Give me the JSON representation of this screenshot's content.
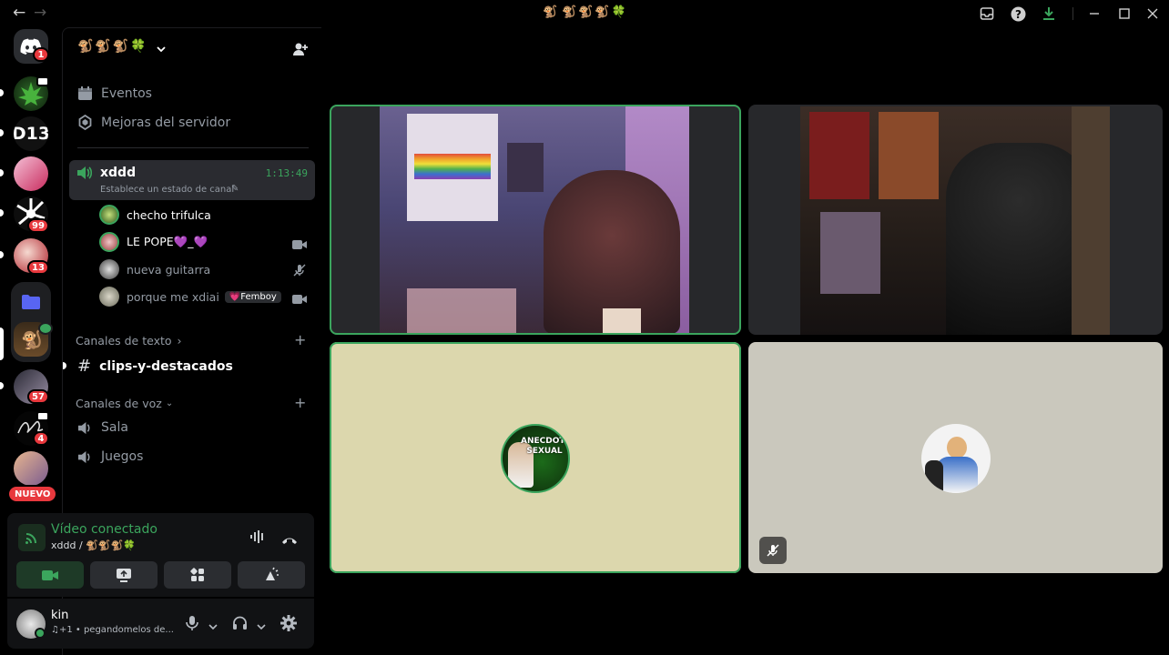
{
  "window": {
    "title": "🐒🐒🐒🍀"
  },
  "rail": {
    "home_badge": "1",
    "badges": [
      "99",
      "13",
      "57",
      "4"
    ],
    "new_label": "NUEVO",
    "d13_label": "D13"
  },
  "sidebar": {
    "server_name": "🐒🐒🐒🍀",
    "items": [
      {
        "label": "Eventos"
      },
      {
        "label": "Mejoras del servidor"
      }
    ],
    "active_voice": {
      "name": "xddd",
      "timer": "1:13:49",
      "status": "Establece un estado de canal"
    },
    "participants": [
      {
        "name": "checho trifulca"
      },
      {
        "name": "LE POPE💜_💜"
      },
      {
        "name": "nueva guitarra"
      },
      {
        "name": "porque me xdiai",
        "tag": "💗Femboy"
      }
    ],
    "text_category": "Canales de texto",
    "text_channels": [
      {
        "name": "clips-y-destacados"
      }
    ],
    "voice_category": "Canales de voz",
    "voice_channels": [
      {
        "name": "Sala"
      },
      {
        "name": "Juegos"
      }
    ]
  },
  "rtc": {
    "status": "Vídeo conectado",
    "location": "xddd / 🐒🐒🐒🍀"
  },
  "user": {
    "name": "kin",
    "activity": "♫+1 • pegandomelos de..."
  },
  "video": {
    "tiles": [
      {
        "kind": "camera",
        "speaking": true
      },
      {
        "kind": "camera",
        "speaking": false
      },
      {
        "kind": "avatar",
        "speaking": true,
        "avatar_text": "ANECDOTA SEXUAL"
      },
      {
        "kind": "avatar",
        "speaking": false,
        "muted": true
      }
    ]
  },
  "colors": {
    "accent_green": "#3ba55d",
    "badge_red": "#e8383d",
    "tile_beige": "#dcd7ad",
    "tile_gray": "#cac8bd"
  }
}
